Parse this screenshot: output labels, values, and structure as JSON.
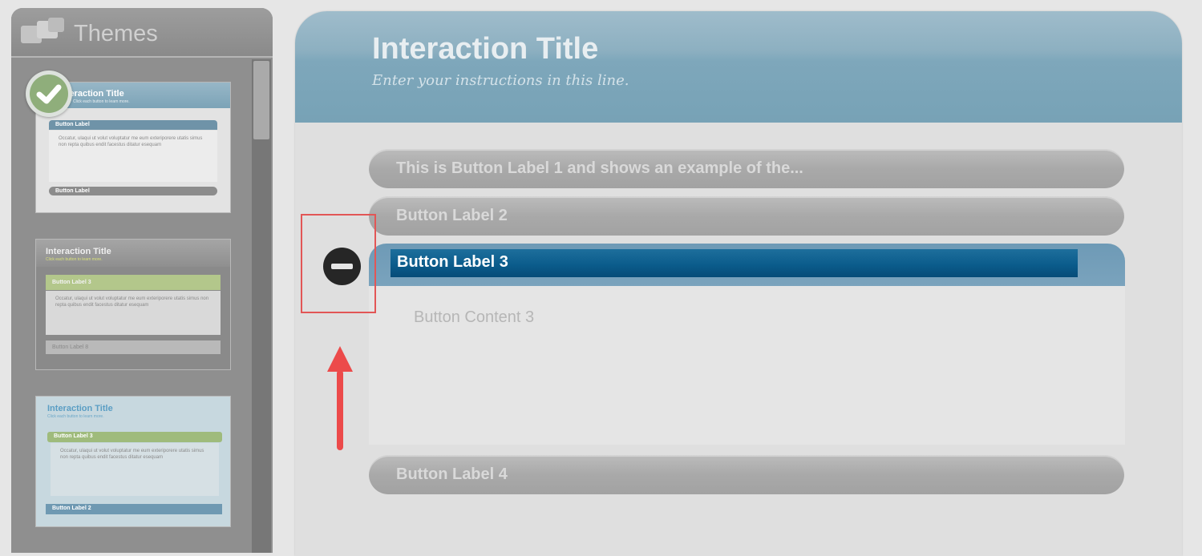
{
  "themes_panel": {
    "title": "Themes",
    "selected_index": 0,
    "theme_previews": [
      {
        "title": "Interaction Title",
        "subtitle": "Click each button to learn more.",
        "button1": "Button Label",
        "body": "Occatur, ulaqui ut volut voluptatur me eum exteriporere utatis simus non repta quibus endit facestus ditatur esequam",
        "button2": "Button Label"
      },
      {
        "title": "Interaction Title",
        "subtitle": "Click each button to learn more.",
        "button1": "Button Label 3",
        "body": "Occatur, ulaqui ut volut voluptatur me eum exteriporere utatis simus non repta quibus endit facestus ditatur esequam",
        "button2": "Button Label 8"
      },
      {
        "title": "Interaction Title",
        "subtitle": "Click each button to learn more.",
        "button1": "Button Label 3",
        "body": "Occatur, ulaqui ut volut voluptatur me eum exteriporere utatis simus non repta quibus endit facestus ditatur esequam",
        "button2": "Button Label 2"
      }
    ]
  },
  "interaction": {
    "title": "Interaction Title",
    "instructions": "Enter your instructions in this line.",
    "buttons": [
      {
        "label": "This is Button Label 1 and shows an example of the..."
      },
      {
        "label": "Button Label 2"
      },
      {
        "label": "Button Label 3",
        "expanded": true,
        "content": "Button Content 3"
      },
      {
        "label": "Button Label 4"
      }
    ]
  },
  "colors": {
    "accent_blue": "#0b5c8c",
    "header_blue": "#7ea7bb",
    "annotation_red": "#e25656",
    "selected_check_green": "#8fae7b"
  },
  "icons": {
    "themes": "themes-icon",
    "selected": "checkmark-icon",
    "collapse": "minus-circle-icon",
    "annotation": "up-arrow-icon"
  }
}
